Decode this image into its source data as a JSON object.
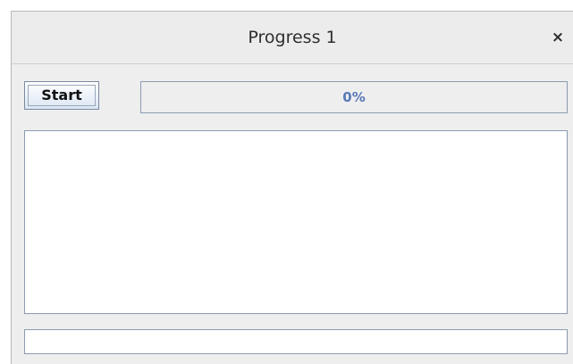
{
  "window": {
    "title": "Progress 1",
    "close_glyph": "×"
  },
  "toolbar": {
    "start_label": "Start"
  },
  "progress": {
    "value": 0,
    "label": "0%"
  },
  "log_area": {
    "text": ""
  },
  "status_field": {
    "value": ""
  },
  "colors": {
    "accent": "#5a79b8",
    "border": "#8a9bb1",
    "button_gradient_bottom": "#dbe6f3"
  },
  "icons": {
    "close": "close-icon"
  }
}
